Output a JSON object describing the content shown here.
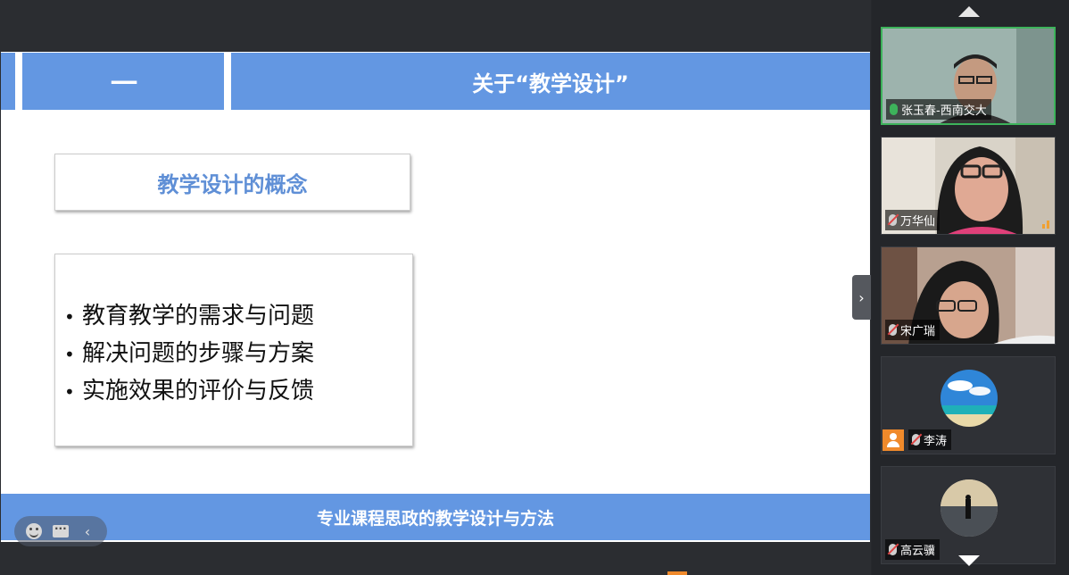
{
  "slide": {
    "section_number": "一",
    "header_title": "关于“教学设计”",
    "concept_title": "教学设计的概念",
    "bullets": [
      "教育教学的需求与问题",
      "解决问题的步骤与方案",
      "实施效果的评价与反馈"
    ],
    "bullet_marker": "•",
    "footer_title": "专业课程思政的教学设计与方法"
  },
  "toolbar": {
    "emoji_icon": "smiley-icon",
    "chat_icon": "chat-icon",
    "collapse_glyph": "‹"
  },
  "side_tab": {
    "glyph": "›"
  },
  "participants": [
    {
      "name": "张玉春-西南交大",
      "mic": "on",
      "video": true,
      "active": true
    },
    {
      "name": "万华仙",
      "mic": "muted",
      "video": true,
      "active": false
    },
    {
      "name": "宋广瑞",
      "mic": "muted",
      "video": true,
      "active": false
    },
    {
      "name": "李涛",
      "mic": "muted",
      "video": false,
      "active": false
    },
    {
      "name": "高云骥",
      "mic": "muted",
      "video": false,
      "active": false
    }
  ],
  "colors": {
    "slide_blue": "#6397e2",
    "concept_text": "#5f8fd6",
    "active_border": "#3db35b",
    "badge_orange": "#f08a2b",
    "panel_bg": "#24262a"
  }
}
